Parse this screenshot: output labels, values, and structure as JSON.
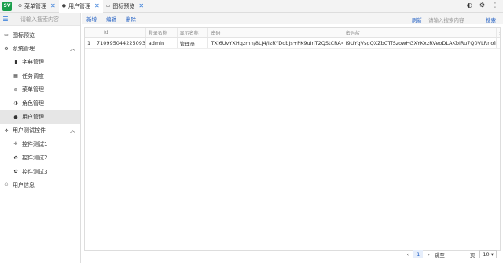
{
  "app": {
    "logo": "SV"
  },
  "tabs": [
    {
      "label": "菜单管理",
      "icon": "menu-icon"
    },
    {
      "label": "用户管理",
      "icon": "user-icon"
    },
    {
      "label": "图标预览",
      "icon": "image-icon"
    }
  ],
  "sidebar": {
    "search_placeholder": "请输入搜索内容",
    "items": [
      {
        "label": "图标预览",
        "icon": "image-icon"
      },
      {
        "label": "系统管理",
        "icon": "gear-icon"
      },
      {
        "label": "字典管理",
        "icon": "book-icon"
      },
      {
        "label": "任务调度",
        "icon": "calendar-icon"
      },
      {
        "label": "菜单管理",
        "icon": "menu-icon"
      },
      {
        "label": "角色管理",
        "icon": "role-icon"
      },
      {
        "label": "用户管理",
        "icon": "user-icon"
      },
      {
        "label": "用户测试控件",
        "icon": "widgets-icon"
      },
      {
        "label": "控件测试1",
        "icon": "move-icon"
      },
      {
        "label": "控件测试2",
        "icon": "paw-icon"
      },
      {
        "label": "控件测试3",
        "icon": "paw-icon"
      },
      {
        "label": "用户信息",
        "icon": "users-icon"
      }
    ]
  },
  "toolbar": {
    "add": "新增",
    "edit": "编辑",
    "delete": "删除",
    "refresh": "刷新",
    "search_placeholder": "请输入搜索内容",
    "search": "搜索"
  },
  "table": {
    "headers": [
      "Id",
      "登录名称",
      "显示名称",
      "密码",
      "密码盐",
      "录"
    ],
    "rows": [
      {
        "index": "1",
        "id": "710995044225093",
        "login": "admin",
        "display": "管理员",
        "password": "TXl6UvYXHqzmn/8LJ4/IzRYDobJs+PK9uInT2QStCRA=",
        "salt": "I9UYqVsgQXZbCTfSzowHGXYKxzRVeoDLAKbIRu7Q0VLRnolR"
      }
    ]
  },
  "pager": {
    "current_page": "1",
    "goto_label": "跳至",
    "page_unit": "页",
    "page_size": "10"
  }
}
